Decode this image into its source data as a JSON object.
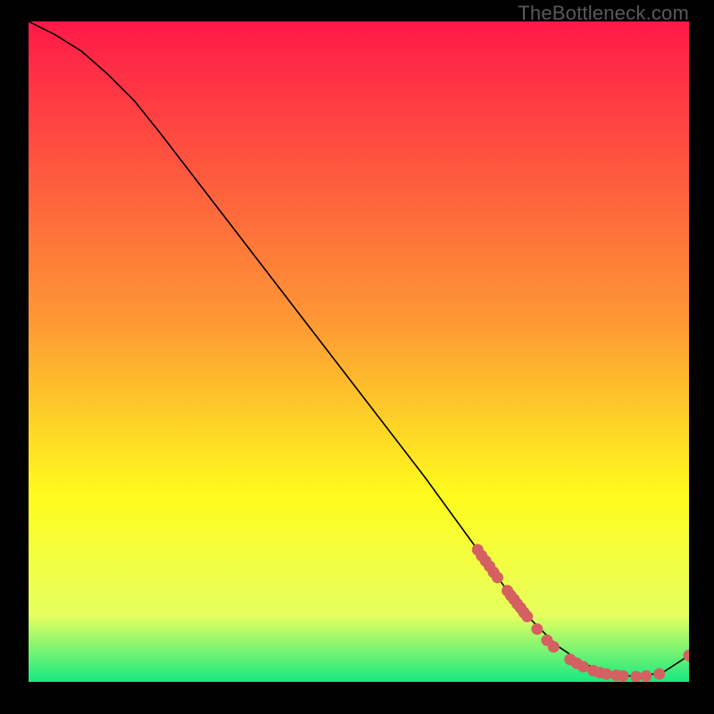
{
  "watermark": "TheBottleneck.com",
  "chart_data": {
    "type": "line",
    "title": "",
    "xlabel": "",
    "ylabel": "",
    "xlim": [
      0,
      100
    ],
    "ylim": [
      0,
      100
    ],
    "grid": false,
    "legend": false,
    "curve": {
      "x": [
        0,
        4,
        8,
        12,
        16,
        20,
        30,
        40,
        50,
        60,
        68,
        72,
        76,
        80,
        84,
        88,
        92,
        96,
        100
      ],
      "y": [
        100,
        98,
        95.5,
        92,
        88,
        83,
        70,
        57,
        44,
        31,
        20,
        14.5,
        9.5,
        5.5,
        2.8,
        1.2,
        0.8,
        1.4,
        4
      ]
    },
    "markers": [
      {
        "x": 68.0,
        "y": 20.0
      },
      {
        "x": 68.6,
        "y": 19.1
      },
      {
        "x": 69.2,
        "y": 18.3
      },
      {
        "x": 69.8,
        "y": 17.5
      },
      {
        "x": 70.4,
        "y": 16.6
      },
      {
        "x": 71.0,
        "y": 15.8
      },
      {
        "x": 72.5,
        "y": 13.8
      },
      {
        "x": 73.0,
        "y": 13.1
      },
      {
        "x": 73.5,
        "y": 12.5
      },
      {
        "x": 74.0,
        "y": 11.8
      },
      {
        "x": 74.5,
        "y": 11.2
      },
      {
        "x": 75.0,
        "y": 10.5
      },
      {
        "x": 75.5,
        "y": 9.9
      },
      {
        "x": 77.0,
        "y": 8.0
      },
      {
        "x": 78.5,
        "y": 6.3
      },
      {
        "x": 79.5,
        "y": 5.3
      },
      {
        "x": 82.0,
        "y": 3.4
      },
      {
        "x": 83.0,
        "y": 2.8
      },
      {
        "x": 84.0,
        "y": 2.3
      },
      {
        "x": 85.5,
        "y": 1.7
      },
      {
        "x": 86.5,
        "y": 1.4
      },
      {
        "x": 87.5,
        "y": 1.2
      },
      {
        "x": 89.0,
        "y": 1.0
      },
      {
        "x": 90.0,
        "y": 0.9
      },
      {
        "x": 92.0,
        "y": 0.8
      },
      {
        "x": 93.5,
        "y": 0.9
      },
      {
        "x": 95.5,
        "y": 1.2
      },
      {
        "x": 100.0,
        "y": 4.0
      }
    ],
    "colors": {
      "curve": "#000000",
      "marker": "#d56061",
      "gradient_top": "#ff1948",
      "gradient_mid1": "#fe9735",
      "gradient_mid2": "#fffc1d",
      "gradient_mid3": "#e6ff60",
      "gradient_bot": "#16e981"
    }
  }
}
